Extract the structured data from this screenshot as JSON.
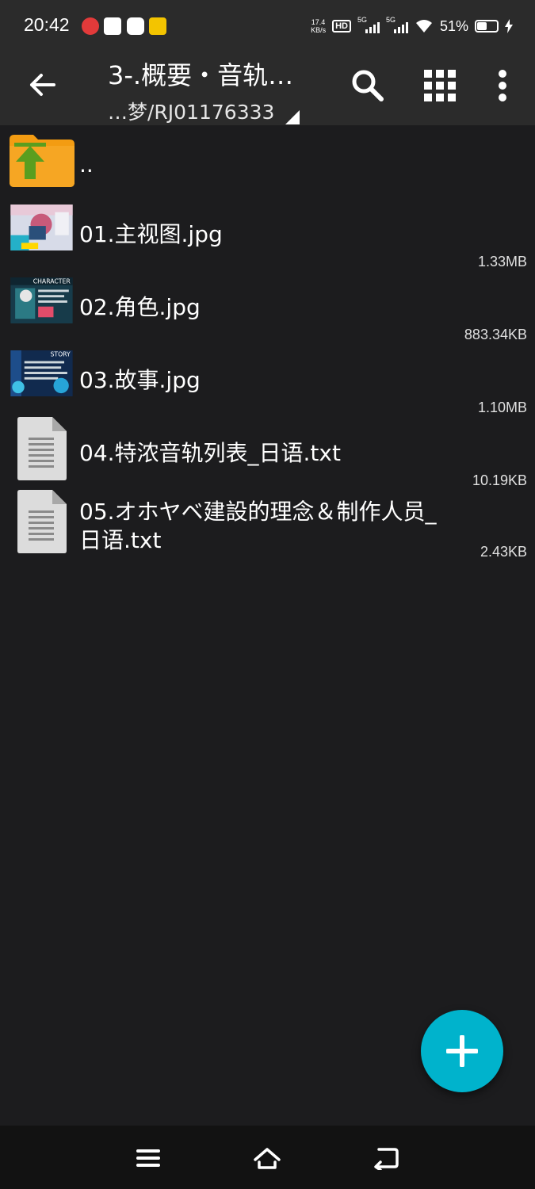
{
  "status_bar": {
    "time": "20:42",
    "net_speed_value": "17.4",
    "net_speed_unit": "KB/s",
    "hd_label": "HD",
    "sim1_label": "5G",
    "sim2_label": "5G",
    "battery_percent": "51%",
    "battery_level": 0.51
  },
  "toolbar": {
    "title": "3-.概要・音轨…",
    "subtitle": "…梦/RJ01176333",
    "back_icon": "arrow-left-icon",
    "search_icon": "search-icon",
    "view_icon": "grid-view-icon",
    "menu_icon": "more-vert-icon"
  },
  "files": [
    {
      "name": "..",
      "size": "",
      "type": "parent"
    },
    {
      "name": "01.主视图.jpg",
      "size": "1.33MB",
      "type": "image"
    },
    {
      "name": "02.角色.jpg",
      "size": "883.34KB",
      "type": "image"
    },
    {
      "name": "03.故事.jpg",
      "size": "1.10MB",
      "type": "image"
    },
    {
      "name": "04.特浓音轨列表_日语.txt",
      "size": "10.19KB",
      "type": "text"
    },
    {
      "name_line1": "05.オホヤベ建設的理念＆制作人员_",
      "name_line2": "日语.txt",
      "size": "2.43KB",
      "type": "text"
    }
  ],
  "thumb_labels": {
    "character": "CHARACTER",
    "story": "STORY"
  },
  "colors": {
    "accent": "#00b3cc",
    "folder": "#f39c12",
    "arrow_up": "#5a9e1f",
    "background": "#1c1c1e",
    "bar": "#2b2b2b"
  },
  "fab": {
    "icon": "plus-icon"
  },
  "nav": {
    "menu_icon": "menu-icon",
    "home_icon": "home-icon",
    "back_icon": "back-icon"
  }
}
